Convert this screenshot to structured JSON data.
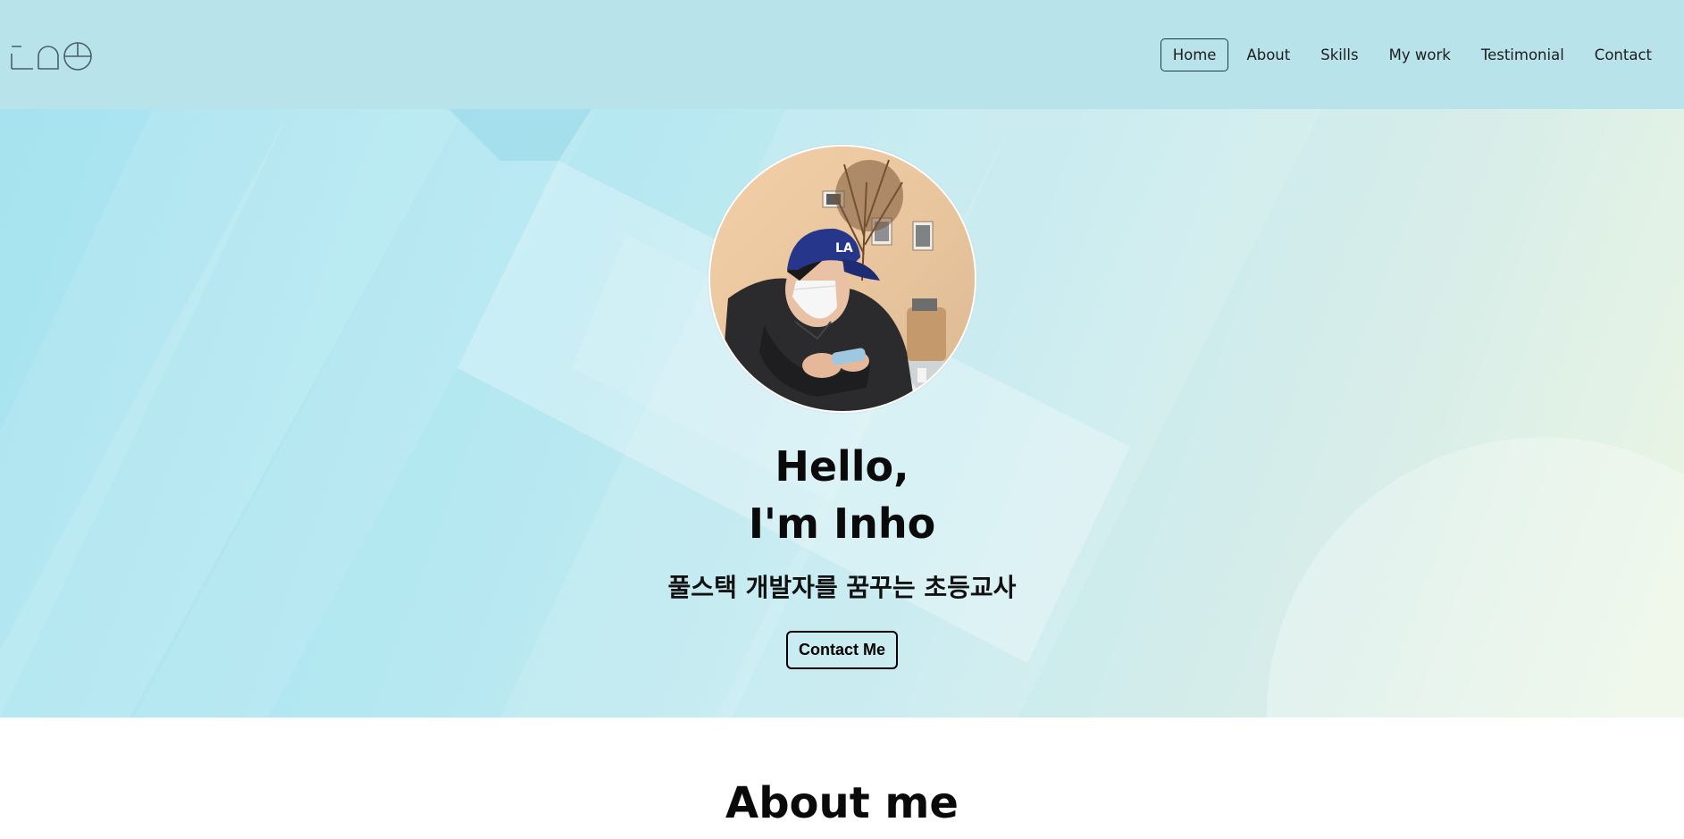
{
  "logo": {
    "alt": "zae logo"
  },
  "nav": {
    "items": [
      {
        "label": "Home",
        "active": true
      },
      {
        "label": "About"
      },
      {
        "label": "Skills"
      },
      {
        "label": "My work"
      },
      {
        "label": "Testimonial"
      },
      {
        "label": "Contact"
      }
    ]
  },
  "hero": {
    "title_line1": "Hello,",
    "title_line2": "I'm Inho",
    "subtitle": "풀스택 개발자를 꿈꾸는 초등교사",
    "contact_button": "Contact Me",
    "avatar_alt": "profile photo"
  },
  "about": {
    "title": "About me"
  },
  "colors": {
    "navbar_bg": "#b9e3ea",
    "hero_gradient_start": "#a6e3ef",
    "hero_gradient_end": "#ecf6e3"
  }
}
